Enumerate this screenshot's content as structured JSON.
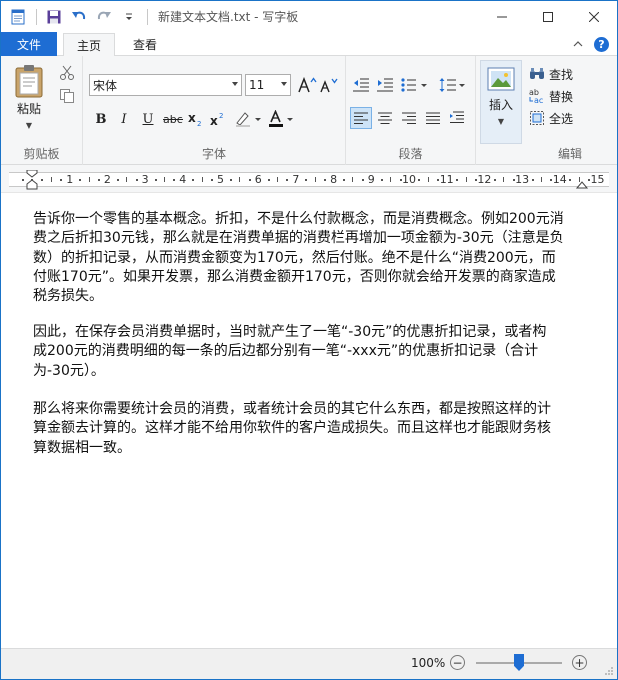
{
  "window": {
    "title": "新建文本文档.txt - 写字板",
    "icons": [
      "wordpad-icon",
      "save-icon",
      "undo-icon",
      "redo-icon",
      "customize-qat-icon",
      "minimize-icon",
      "maximize-icon",
      "close-icon"
    ]
  },
  "tabs": {
    "file": "文件",
    "home": "主页",
    "view": "查看"
  },
  "ribbon": {
    "clipboard": {
      "paste": "粘贴",
      "group_label": "剪贴板"
    },
    "font": {
      "family": "宋体",
      "size": "11",
      "group_label": "字体"
    },
    "paragraph": {
      "group_label": "段落"
    },
    "insert": {
      "label": "插入"
    },
    "editing": {
      "find": "查找",
      "replace": "替换",
      "select_all": "全选",
      "group_label": "编辑"
    }
  },
  "ruler": {
    "numbers": [
      "1",
      "2",
      "3",
      "4",
      "5",
      "6",
      "7",
      "8",
      "9",
      "10",
      "11",
      "12",
      "13",
      "14",
      "15"
    ]
  },
  "document": {
    "p1": [
      "告诉你一个零售的基本概念。折扣，不是什么付款概念，而是消费概念。例如200元消",
      "费之后折扣30元钱，那么就是在消费单据的消费栏再增加一项金额为-30元（注意是负",
      "数）的折扣记录，从而消费金额变为170元，然后付账。绝不是什么“消费200元，而",
      "付账170元”。如果开发票，那么消费金额开170元，否则你就会给开发票的商家造成",
      "税务损失。"
    ],
    "p2": [
      "因此，在保存会员消费单据时，当时就产生了一笔“-30元”的优惠折扣记录，或者构",
      "成200元的消费明细的每一条的后边都分别有一笔“-xxx元”的优惠折扣记录（合计",
      "为-30元）。"
    ],
    "p3": [
      "那么将来你需要统计会员的消费，或者统计会员的其它什么东西，都是按照这样的计",
      "算金额去计算的。这样才能不给用你软件的客户造成损失。而且这样也才能跟财务核",
      "算数据相一致。"
    ]
  },
  "status": {
    "zoom": "100%",
    "zoom_out": "−",
    "zoom_in": "+",
    "zoom_level": 0.5
  },
  "colors": {
    "accent": "#1e6dd3",
    "ribbon_bg": "#f5f6f7"
  }
}
